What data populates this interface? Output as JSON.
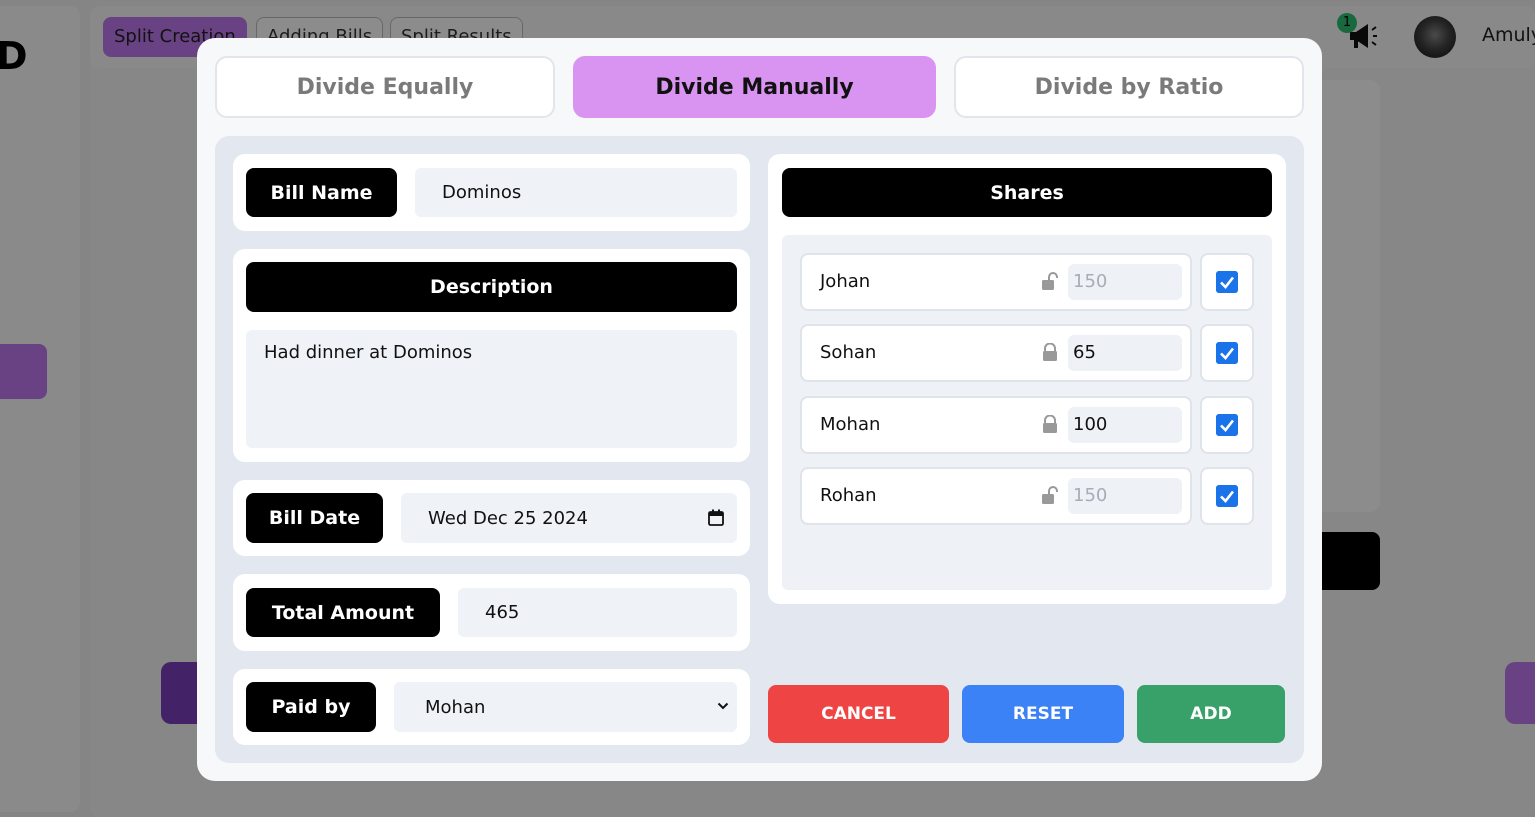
{
  "background": {
    "logo_letter": "D",
    "tabs": [
      "Split Creation",
      "Adding Bills",
      "Split Results"
    ],
    "notification_count": "1",
    "username": "Amuly"
  },
  "modal": {
    "mode_tabs": [
      {
        "label": "Divide Equally",
        "active": false
      },
      {
        "label": "Divide Manually",
        "active": true
      },
      {
        "label": "Divide by Ratio",
        "active": false
      }
    ],
    "bill_name": {
      "label": "Bill Name",
      "value": "Dominos"
    },
    "description": {
      "label": "Description",
      "value": "Had dinner at Dominos"
    },
    "bill_date": {
      "label": "Bill Date",
      "value": "Wed Dec 25 2024"
    },
    "total_amount": {
      "label": "Total Amount",
      "value": "465"
    },
    "paid_by": {
      "label": "Paid by",
      "value": "Mohan"
    },
    "shares": {
      "title": "Shares",
      "rows": [
        {
          "name": "Johan",
          "amount": "150",
          "locked": false,
          "checked": true
        },
        {
          "name": "Sohan",
          "amount": "65",
          "locked": true,
          "checked": true
        },
        {
          "name": "Mohan",
          "amount": "100",
          "locked": true,
          "checked": true
        },
        {
          "name": "Rohan",
          "amount": "150",
          "locked": false,
          "checked": true
        }
      ]
    },
    "buttons": {
      "cancel": "CANCEL",
      "reset": "RESET",
      "add": "ADD"
    },
    "colors": {
      "active_tab": "#d994f2",
      "cancel": "#ef4444",
      "reset": "#3b82f6",
      "add": "#38a169",
      "checkbox": "#1a73e8"
    }
  }
}
